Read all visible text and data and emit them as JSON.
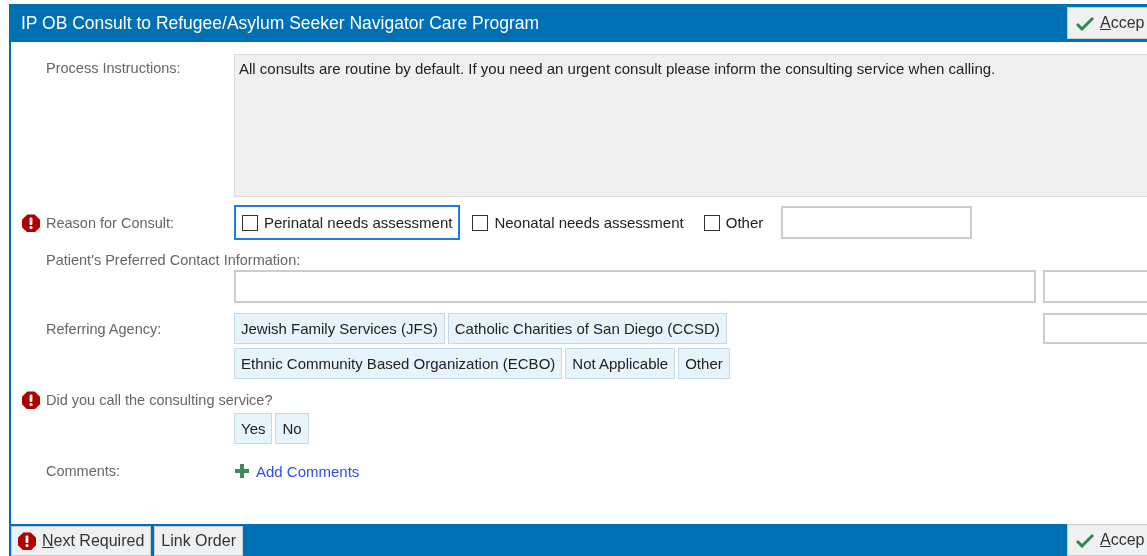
{
  "window": {
    "title": "IP OB Consult to Refugee/Asylum Seeker Navigator Care Program",
    "accept_button": "Accep"
  },
  "process_instructions": {
    "label": "Process Instructions:",
    "text": "All consults are routine by default. If you need an urgent consult please inform the consulting service when calling."
  },
  "reason_for_consult": {
    "label": "Reason for Consult:",
    "required": true,
    "options": [
      {
        "label": "Perinatal needs assessment",
        "checked": false,
        "focused": true
      },
      {
        "label": "Neonatal needs assessment",
        "checked": false,
        "focused": false
      },
      {
        "label": "Other",
        "checked": false,
        "focused": false
      }
    ]
  },
  "preferred_contact": {
    "label": "Patient's Preferred Contact Information:"
  },
  "referring_agency": {
    "label": "Referring Agency:",
    "options": [
      {
        "label": "Jewish Family Services (JFS)",
        "selected": false
      },
      {
        "label": "Catholic Charities of San Diego (CCSD)",
        "selected": false
      },
      {
        "label": "Ethnic Community Based Organization (ECBO)",
        "selected": false
      },
      {
        "label": "Not Applicable",
        "selected": false
      },
      {
        "label": "Other",
        "selected": false
      }
    ]
  },
  "called_consulting_service": {
    "label": "Did you call the consulting service?",
    "required": true,
    "options": [
      {
        "label": "Yes",
        "selected": false
      },
      {
        "label": "No",
        "selected": false
      }
    ]
  },
  "comments": {
    "label": "Comments:",
    "link": "Add Comments"
  },
  "footer": {
    "next_required_button": "Next Required",
    "link_order_button": "Link Order",
    "accept_button": "Accep"
  }
}
